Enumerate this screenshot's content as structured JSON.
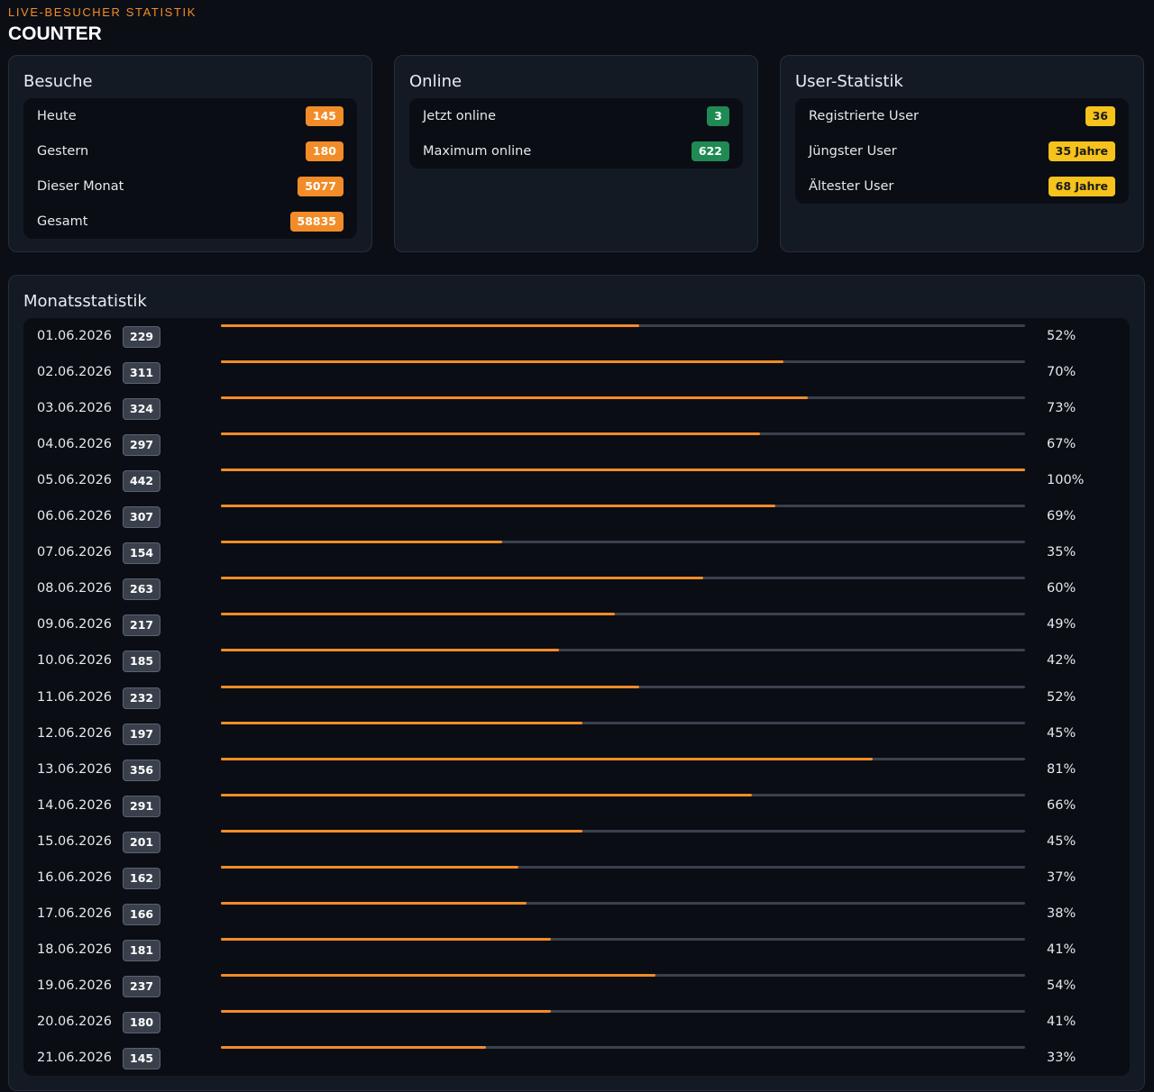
{
  "header": {
    "eyebrow": "LIVE-BESUCHER STATISTIK",
    "title": "COUNTER"
  },
  "visits": {
    "title": "Besuche",
    "rows": [
      {
        "label": "Heute",
        "value": "145"
      },
      {
        "label": "Gestern",
        "value": "180"
      },
      {
        "label": "Dieser Monat",
        "value": "5077"
      },
      {
        "label": "Gesamt",
        "value": "58835"
      }
    ]
  },
  "online": {
    "title": "Online",
    "rows": [
      {
        "label": "Jetzt online",
        "value": "3"
      },
      {
        "label": "Maximum online",
        "value": "622"
      }
    ]
  },
  "users": {
    "title": "User-Statistik",
    "rows": [
      {
        "label": "Registrierte User",
        "value": "36"
      },
      {
        "label": "Jüngster User",
        "value": "35 Jahre"
      },
      {
        "label": "Ältester User",
        "value": "68 Jahre"
      }
    ]
  },
  "monthly": {
    "title": "Monatsstatistik",
    "days": [
      {
        "date": "01.06.2026",
        "count": "229",
        "percent": "52%"
      },
      {
        "date": "02.06.2026",
        "count": "311",
        "percent": "70%"
      },
      {
        "date": "03.06.2026",
        "count": "324",
        "percent": "73%"
      },
      {
        "date": "04.06.2026",
        "count": "297",
        "percent": "67%"
      },
      {
        "date": "05.06.2026",
        "count": "442",
        "percent": "100%"
      },
      {
        "date": "06.06.2026",
        "count": "307",
        "percent": "69%"
      },
      {
        "date": "07.06.2026",
        "count": "154",
        "percent": "35%"
      },
      {
        "date": "08.06.2026",
        "count": "263",
        "percent": "60%"
      },
      {
        "date": "09.06.2026",
        "count": "217",
        "percent": "49%"
      },
      {
        "date": "10.06.2026",
        "count": "185",
        "percent": "42%"
      },
      {
        "date": "11.06.2026",
        "count": "232",
        "percent": "52%"
      },
      {
        "date": "12.06.2026",
        "count": "197",
        "percent": "45%"
      },
      {
        "date": "13.06.2026",
        "count": "356",
        "percent": "81%"
      },
      {
        "date": "14.06.2026",
        "count": "291",
        "percent": "66%"
      },
      {
        "date": "15.06.2026",
        "count": "201",
        "percent": "45%"
      },
      {
        "date": "16.06.2026",
        "count": "162",
        "percent": "37%"
      },
      {
        "date": "17.06.2026",
        "count": "166",
        "percent": "38%"
      },
      {
        "date": "18.06.2026",
        "count": "181",
        "percent": "41%"
      },
      {
        "date": "19.06.2026",
        "count": "237",
        "percent": "54%"
      },
      {
        "date": "20.06.2026",
        "count": "180",
        "percent": "41%"
      },
      {
        "date": "21.06.2026",
        "count": "145",
        "percent": "33%"
      }
    ]
  },
  "colors": {
    "accent": "#f28c28",
    "online_badge": "#1f8a54",
    "user_badge": "#f6c21c",
    "background": "#0b0e15",
    "card": "#141a24"
  }
}
